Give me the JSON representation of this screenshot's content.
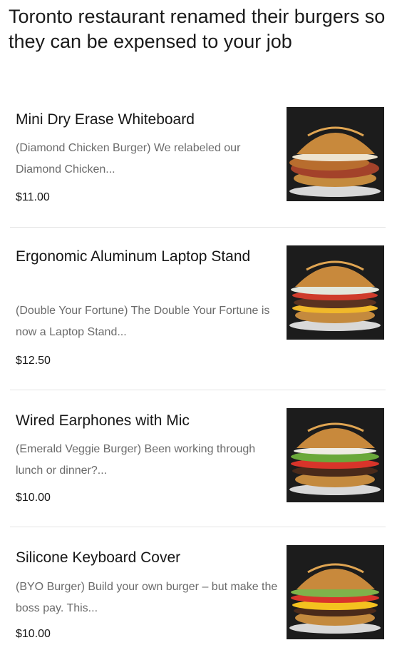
{
  "headline": "Toronto restaurant renamed their burgers so they can be expensed to your job",
  "items": [
    {
      "title": "Mini Dry Erase Whiteboard",
      "description": "(Diamond Chicken Burger) We relabeled our Diamond Chicken...",
      "price": "$11.00",
      "image_icon": "chicken-burger-photo"
    },
    {
      "title": "Ergonomic Aluminum Laptop Stand",
      "description": "(Double Your Fortune) The Double Your Fortune is now a Laptop Stand...",
      "price": "$12.50",
      "image_icon": "double-burger-photo"
    },
    {
      "title": "Wired Earphones with Mic",
      "description": "(Emerald Veggie Burger) Been working through lunch or dinner?...",
      "price": "$10.00",
      "image_icon": "veggie-burger-photo"
    },
    {
      "title": "Silicone Keyboard Cover",
      "description": "(BYO Burger) Build your own burger – but make the boss pay. This...",
      "price": "$10.00",
      "image_icon": "byo-burger-photo"
    }
  ],
  "colors": {
    "title_text": "#161616",
    "description_text": "#6b6b6b",
    "photo_background": "#1c1c1c",
    "bun": "#c8893c"
  }
}
